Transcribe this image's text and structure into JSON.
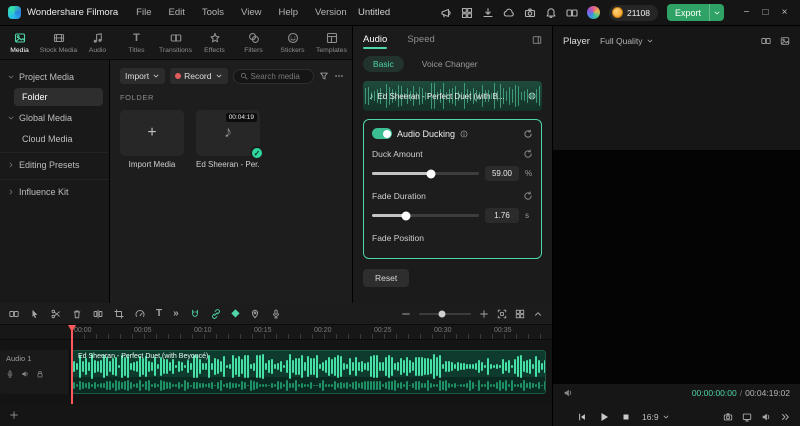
{
  "colors": {
    "accent": "#4fd6a6",
    "export_green": "#2ea365",
    "coin_orange": "#f39b1d",
    "record_red": "#e05c5c",
    "waveform": "#46e0a6",
    "playhead_red": "#ff5a5a"
  },
  "titlebar": {
    "app_name": "Wondershare Filmora",
    "menus": [
      "File",
      "Edit",
      "Tools",
      "View",
      "Help",
      "Version"
    ],
    "project_title": "Untitled",
    "coin_count": "21108",
    "export_label": "Export"
  },
  "media_tabs": {
    "items": [
      "Media",
      "Stock Media",
      "Audio",
      "Titles",
      "Transitions",
      "Effects",
      "Filters",
      "Stickers",
      "Templates"
    ]
  },
  "sidebar": {
    "items": [
      "Project Media",
      "Folder",
      "Global Media",
      "Cloud Media",
      "Editing Presets",
      "Influence Kit"
    ]
  },
  "media_toolbar": {
    "import": "Import",
    "record": "Record",
    "search_placeholder": "Search media"
  },
  "folder": {
    "title": "FOLDER",
    "import_tile": "Import Media",
    "audio_tile": "Ed Sheeran - Per...",
    "audio_duration": "00:04:19"
  },
  "props": {
    "tab_audio": "Audio",
    "tab_speed": "Speed",
    "subtab_basic": "Basic",
    "subtab_voice": "Voice Changer",
    "clip_title": "Ed Sheeran - Perfect Duet (with B...",
    "ducking_title": "Audio Ducking",
    "duck_amount": {
      "label": "Duck Amount",
      "value": "59.00",
      "unit": "%"
    },
    "fade_duration": {
      "label": "Fade Duration",
      "value": "1.76",
      "unit": "s"
    },
    "fade_position_label": "Fade Position",
    "reset_label": "Reset"
  },
  "player": {
    "title": "Player",
    "quality": "Full Quality",
    "current_time": "00:00:00:00",
    "separator": "/",
    "total_time": "00:04:19:02",
    "aspect": "16:9"
  },
  "timeline": {
    "ruler": [
      "00:00",
      "00:05",
      "00:10",
      "00:15",
      "00:20",
      "00:25",
      "00:30",
      "00:35"
    ],
    "track_label": "Audio 1",
    "clip_title": "Ed Sheeran - Perfect Duet (with Beyoncé)"
  }
}
